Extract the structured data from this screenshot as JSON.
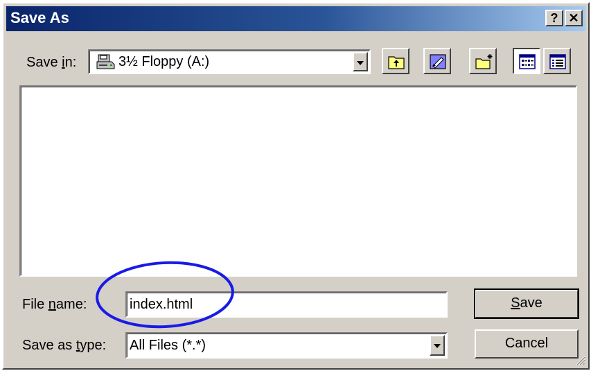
{
  "window": {
    "title": "Save As"
  },
  "titlebar_buttons": {
    "help": "?",
    "close": "✕"
  },
  "save_in": {
    "label_before": "Save ",
    "label_underline": "i",
    "label_after": "n:",
    "value": "3½ Floppy (A:)"
  },
  "toolbar": {
    "icons": [
      "up-one-level-icon",
      "desktop-icon",
      "new-folder-icon",
      "list-view-icon",
      "details-view-icon"
    ]
  },
  "file_name": {
    "label_before": "File ",
    "label_underline": "n",
    "label_after": "ame:",
    "value": "index.html"
  },
  "save_as_type": {
    "label_before": "Save as ",
    "label_underline": "t",
    "label_after": "ype:",
    "value": "All Files (*.*)"
  },
  "buttons": {
    "save_underline": "S",
    "save_rest": "ave",
    "cancel": "Cancel"
  },
  "colors": {
    "titlebar_start": "#0a246a",
    "titlebar_end": "#a6caf0",
    "dialog_face": "#d4d0c8",
    "highlight_circle": "#1a1ae6"
  }
}
